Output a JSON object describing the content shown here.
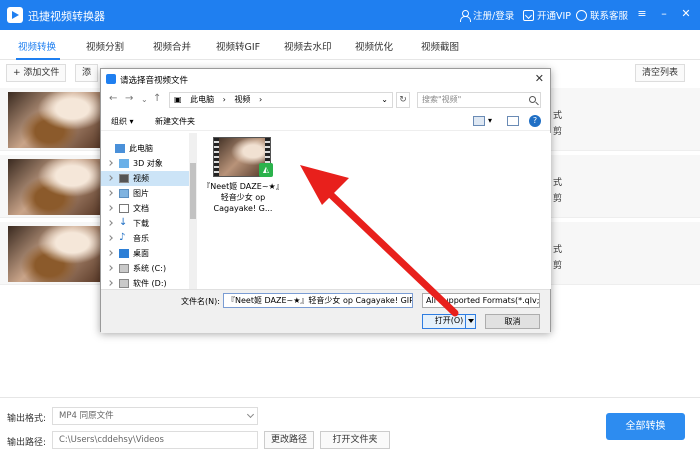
{
  "app": {
    "title": "迅捷视频转换器",
    "register_login": "注册/登录",
    "vip": "开通VIP",
    "support": "联系客服"
  },
  "tabs": [
    "视频转换",
    "视频分割",
    "视频合并",
    "视频转GIF",
    "视频去水印",
    "视频优化",
    "视频截图"
  ],
  "active_tab": "视频转换",
  "toolbar": {
    "add_file": "+ 添加文件",
    "add_folder": "添",
    "clear_list": "清空列表"
  },
  "rows": [
    {
      "info_1": "式",
      "info_2": "剪"
    },
    {
      "info_1": "式",
      "info_2": "剪"
    },
    {
      "info_1": "式",
      "info_2": "剪"
    }
  ],
  "bottom": {
    "format_label": "输出格式:",
    "format_value": "MP4  同原文件",
    "path_label": "输出路径:",
    "path_value": "C:\\Users\\cddehsy\\Videos",
    "change_path": "更改路径",
    "open_folder": "打开文件夹",
    "convert_all": "全部转换"
  },
  "dialog": {
    "title": "请选择音视频文件",
    "close": "✕",
    "address": [
      "此电脑",
      "›",
      "视频",
      "›"
    ],
    "search_placeholder": "搜索\"视频\"",
    "organize": "组织 ▾",
    "new_folder": "新建文件夹",
    "help": "?",
    "tree": [
      {
        "label": "此电脑",
        "icon": "computer-icon"
      },
      {
        "label": "3D 对象",
        "icon": "3d-objects-icon"
      },
      {
        "label": "视频",
        "icon": "video-folder-icon",
        "selected": true
      },
      {
        "label": "图片",
        "icon": "pictures-icon"
      },
      {
        "label": "文档",
        "icon": "documents-icon"
      },
      {
        "label": "下载",
        "icon": "download-icon"
      },
      {
        "label": "音乐",
        "icon": "music-icon"
      },
      {
        "label": "桌面",
        "icon": "desktop-icon"
      },
      {
        "label": "系统 (C:)",
        "icon": "drive-icon"
      },
      {
        "label": "软件 (D:)",
        "icon": "drive-icon"
      }
    ],
    "file": {
      "name": "『Neet姬 DAZE~★』轻音少女 op Cagayake! G..."
    },
    "filename_label": "文件名(N):",
    "filename_value": "『Neet姬 DAZE~★』轻音少女 op Cagayake! GIR",
    "format_filter": "All Supported Formats(*.qlv;",
    "open_button": "打开(O)",
    "cancel_button": "取消"
  },
  "colors": {
    "brand": "#1f7ff0",
    "arrow": "#e8201c",
    "convert_button": "#2d8cf0"
  }
}
